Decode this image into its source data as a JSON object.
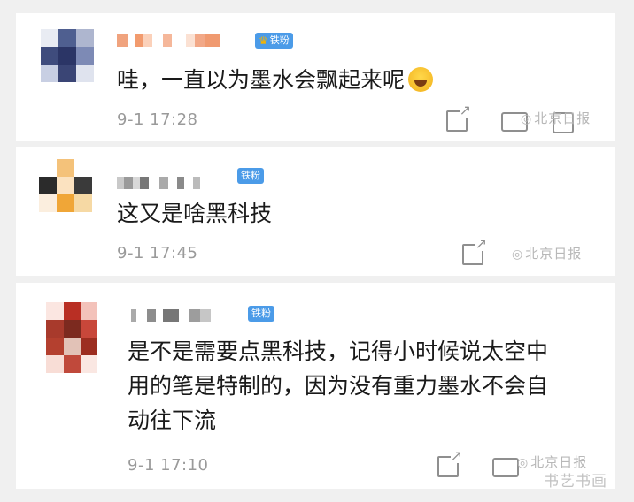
{
  "comments": [
    {
      "badge": "铁粉",
      "text": "哇，一直以为墨水会飘起来呢",
      "time": "9-1 17:28",
      "watermark": "北京日报"
    },
    {
      "badge": "铁粉",
      "text": "这又是啥黑科技",
      "time": "9-1 17:45",
      "watermark": "北京日报"
    },
    {
      "badge": "铁粉",
      "text_lines": [
        "是不是需要点黑科技，记得小时候说太空中",
        "用的笔是特制的，因为没有重力墨水不会自",
        "动往下流"
      ],
      "time": "9-1 17:10",
      "watermark": "北京日报"
    }
  ],
  "bottom_watermark": "书艺书画室",
  "icons": {
    "share": "share-icon",
    "comment": "comment-icon",
    "like": "like-icon",
    "emoji": "laugh-cry-emoji"
  },
  "colors": {
    "badge_bg": "#4b9be8",
    "time_text": "#9a9a9a",
    "body_text": "#1a1a1a"
  }
}
